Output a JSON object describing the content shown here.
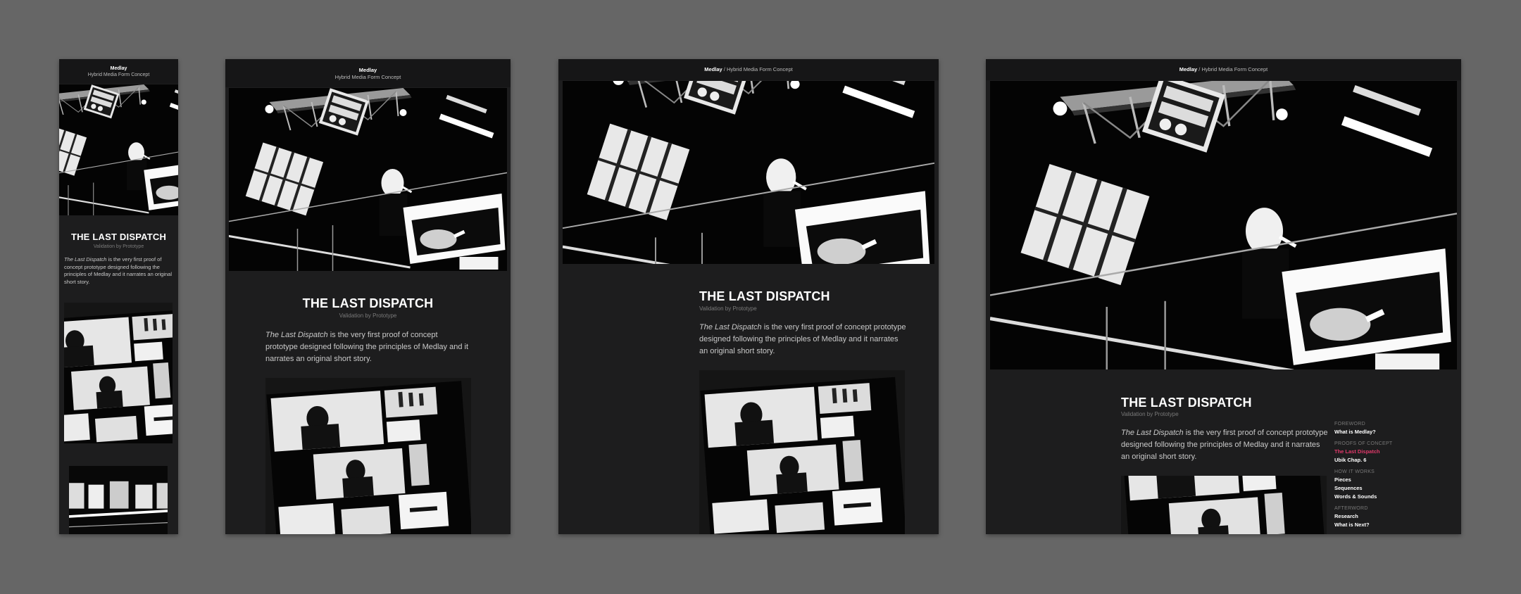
{
  "brand": "Medlay",
  "tagline": "Hybrid Media Form Concept",
  "separator": "/",
  "article": {
    "title": "THE LAST DISPATCH",
    "subtitle": "Validation by Prototype",
    "intro_italic": "The Last Dispatch",
    "intro_rest": " is the very first proof of concept prototype designed following the principles of Medlay and it narrates an original short story."
  },
  "nav": {
    "sections": [
      {
        "label": "FOREWORD",
        "items": [
          {
            "label": "What is Medlay?",
            "active": false
          }
        ]
      },
      {
        "label": "PROOFS OF CONCEPT",
        "items": [
          {
            "label": "The Last Dispatch",
            "active": true
          },
          {
            "label": "Ubik Chap. 6",
            "active": false
          }
        ]
      },
      {
        "label": "HOW IT WORKS",
        "items": [
          {
            "label": "Pieces",
            "active": false
          },
          {
            "label": "Sequences",
            "active": false
          },
          {
            "label": "Words & Sounds",
            "active": false
          }
        ]
      },
      {
        "label": "AFTERWORD",
        "items": [
          {
            "label": "Research",
            "active": false
          },
          {
            "label": "What is Next?",
            "active": false
          }
        ]
      }
    ]
  },
  "colors": {
    "background": "#666666",
    "frame": "#1d1d1e",
    "accent": "#e0396a"
  }
}
